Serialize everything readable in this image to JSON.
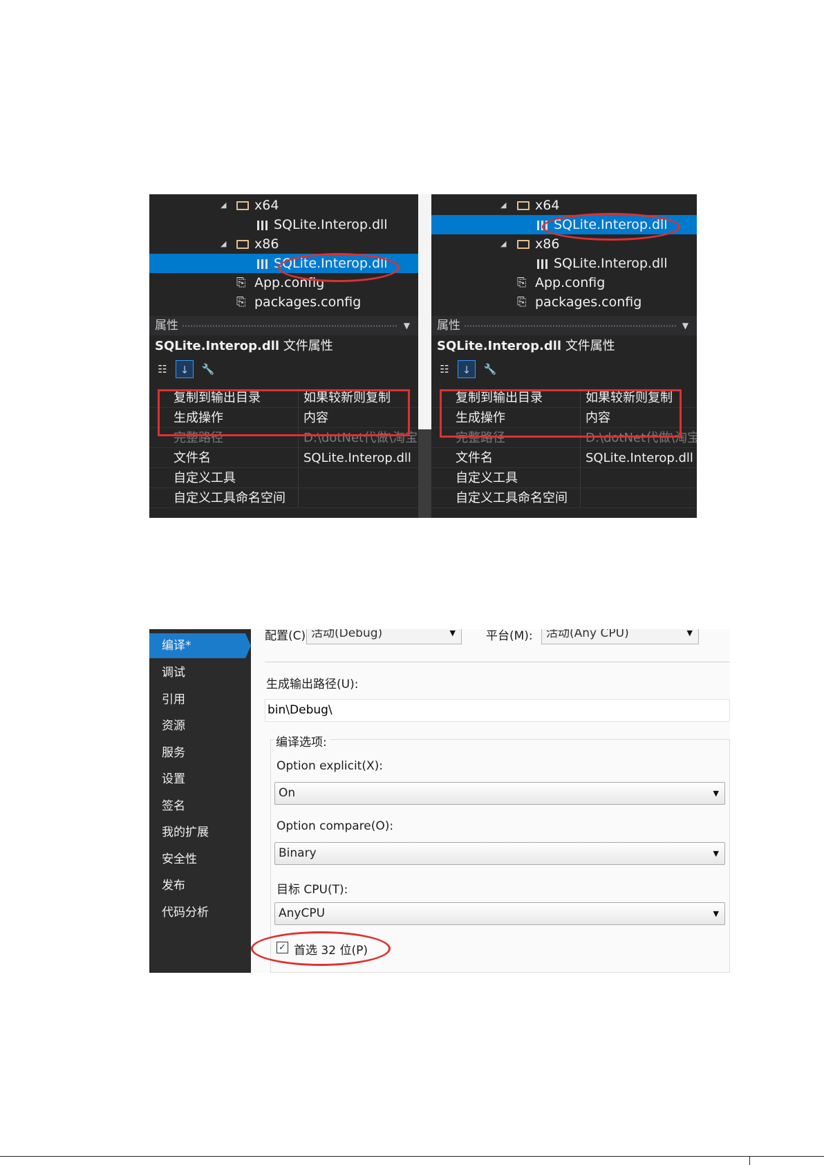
{
  "panels": [
    {
      "tree": [
        {
          "label": "x64",
          "kind": "folder"
        },
        {
          "label": "SQLite.Interop.dll",
          "kind": "dll"
        },
        {
          "label": "x86",
          "kind": "folder"
        },
        {
          "label": "SQLite.Interop.dll",
          "kind": "dll",
          "selected": true
        },
        {
          "label": "App.config",
          "kind": "config"
        },
        {
          "label": "packages.config",
          "kind": "config"
        }
      ],
      "props_header": "属性",
      "props_title_name": "SQLite.Interop.dll",
      "props_title_suffix": "文件属性",
      "rows": [
        {
          "name": "复制到输出目录",
          "value": "如果较新则复制"
        },
        {
          "name": "生成操作",
          "value": "内容"
        },
        {
          "name": "完整路径",
          "value": "D:\\dotNet代做\\淘宝",
          "dim": true
        },
        {
          "name": "文件名",
          "value": "SQLite.Interop.dll"
        },
        {
          "name": "自定义工具",
          "value": ""
        },
        {
          "name": "自定义工具命名空间",
          "value": ""
        }
      ]
    },
    {
      "tree": [
        {
          "label": "x64",
          "kind": "folder"
        },
        {
          "label": "SQLite.Interop.dll",
          "kind": "dll",
          "selected": true
        },
        {
          "label": "x86",
          "kind": "folder"
        },
        {
          "label": "SQLite.Interop.dll",
          "kind": "dll"
        },
        {
          "label": "App.config",
          "kind": "config"
        },
        {
          "label": "packages.config",
          "kind": "config"
        }
      ],
      "props_header": "属性",
      "props_title_name": "SQLite.Interop.dll",
      "props_title_suffix": "文件属性",
      "rows": [
        {
          "name": "复制到输出目录",
          "value": "如果较新则复制"
        },
        {
          "name": "生成操作",
          "value": "内容"
        },
        {
          "name": "完整路径",
          "value": "D:\\dotNet代做\\淘宝",
          "dim": true
        },
        {
          "name": "文件名",
          "value": "SQLite.Interop.dll"
        },
        {
          "name": "自定义工具",
          "value": ""
        },
        {
          "name": "自定义工具命名空间",
          "value": ""
        }
      ]
    }
  ],
  "project": {
    "nav": [
      "编译*",
      "调试",
      "引用",
      "资源",
      "服务",
      "设置",
      "签名",
      "我的扩展",
      "安全性",
      "发布",
      "代码分析"
    ],
    "active_nav": 0,
    "config_label": "配置(C):",
    "config_value": "活动(Debug)",
    "platform_label": "平台(M):",
    "platform_value": "活动(Any CPU)",
    "output_path_label": "生成输出路径(U):",
    "output_path_value": "bin\\Debug\\",
    "compile_options_label": "编译选项:",
    "option_explicit_label": "Option explicit(X):",
    "option_explicit_value": "On",
    "option_compare_label": "Option compare(O):",
    "option_compare_value": "Binary",
    "target_cpu_label": "目标 CPU(T):",
    "target_cpu_value": "AnyCPU",
    "prefer32_label": "首选 32 位(P)",
    "prefer32_checked": true
  },
  "colors": {
    "highlight": "#e03030",
    "selection": "#007acc",
    "nav_active": "#1c7ccc"
  }
}
